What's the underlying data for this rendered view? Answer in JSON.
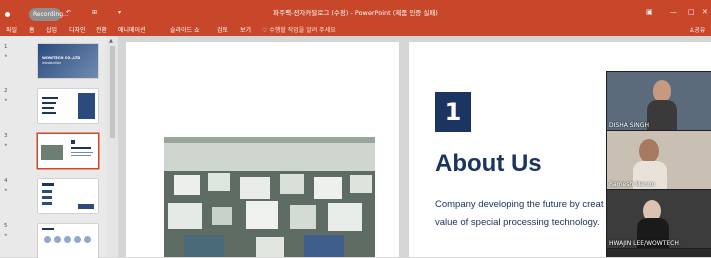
{
  "titlebar": {
    "recording_label": "Recording...",
    "title": "파주팩-전자카탈로그 (수정) - PowerPoint (제품 인증 실패)",
    "window_buttons": [
      "—",
      "□",
      "✕"
    ]
  },
  "menu": {
    "items": [
      "파일",
      "홈",
      "삽입",
      "디자인",
      "전환",
      "애니메이션",
      "슬라이드 쇼",
      "검토",
      "보기"
    ],
    "tell_me": "수행할 작업을 알려 주세요",
    "share": "공유"
  },
  "thumbnails": [
    {
      "number": "1",
      "title": "WOWTECH CO.,LTD",
      "subtitle": "Introduction"
    },
    {
      "number": "2"
    },
    {
      "number": "3",
      "selected": true
    },
    {
      "number": "4"
    },
    {
      "number": "5"
    }
  ],
  "slide": {
    "number": "1",
    "heading": "About Us",
    "line1": "Company developing the future by creat",
    "line2": "value of special processing technology."
  },
  "participants": [
    {
      "name": "DISHA SINGH"
    },
    {
      "name": "Ramesh Menon"
    },
    {
      "name": "HWAJIN LEE/WOWTECH"
    },
    {
      "name": ""
    }
  ],
  "colors": {
    "accent": "#c8472a",
    "navy": "#1c3461"
  }
}
